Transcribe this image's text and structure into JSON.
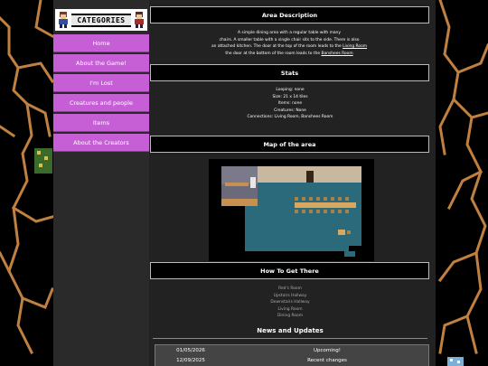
{
  "sidebar": {
    "banner_label": "CATEGORIES",
    "nav_items": [
      {
        "label": "Home"
      },
      {
        "label": "About the Game!"
      },
      {
        "label": "I'm Lost"
      },
      {
        "label": "Creatures and people"
      },
      {
        "label": "Items"
      },
      {
        "label": "About the Creators"
      }
    ]
  },
  "sections": {
    "area_description": "Area Description",
    "stats": "Stats",
    "map": "Map of the area",
    "how_to": "How To Get There"
  },
  "description": {
    "line1": "A simple dining area with a regular table with many",
    "line2": "chairs. A smaller table with a single chair sits to the side. There is also",
    "line3_prefix": "an attached kitchen. The door at the top of the room leads to the ",
    "line3_link": "Living Room",
    "line4_prefix": "the door at the bottom of the room leads to the ",
    "line4_link": "Banshees Room"
  },
  "stats": {
    "looping": "Looping: none",
    "size": "Size: 21 x 14 tiles",
    "items": "Items: none",
    "creatures": "Creatures: None",
    "connections": "Connections: Living Room, Banshees Room"
  },
  "how_to": [
    "Red's Room",
    "Upstairs Hallway",
    "Downstairs Hallway",
    "Living Room",
    "Dining Room"
  ],
  "news": {
    "title": "News and Updates",
    "rows": [
      {
        "date": "01/05/2026",
        "title": "Upcoming!"
      },
      {
        "date": "12/09/2025",
        "title": "Recent changes"
      }
    ]
  },
  "colors": {
    "nav_accent": "#c65fd6",
    "background": "#000000",
    "panel": "#222222",
    "root_lines": "#c08040"
  }
}
